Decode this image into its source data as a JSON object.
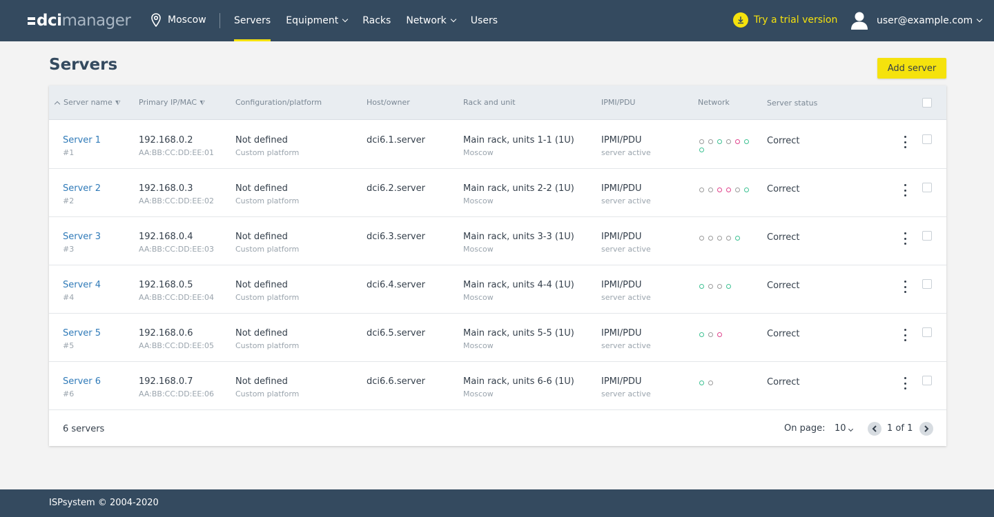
{
  "app": {
    "logo_dci": "dci",
    "logo_manager": "manager"
  },
  "header": {
    "location": "Moscow",
    "nav": [
      {
        "label": "Servers",
        "active": true,
        "dropdown": false
      },
      {
        "label": "Equipment",
        "active": false,
        "dropdown": true
      },
      {
        "label": "Racks",
        "active": false,
        "dropdown": false
      },
      {
        "label": "Network",
        "active": false,
        "dropdown": true
      },
      {
        "label": "Users",
        "active": false,
        "dropdown": false
      }
    ],
    "trial": "Try a trial version",
    "user": "user@example.com"
  },
  "page": {
    "title": "Servers",
    "add_button": "Add server"
  },
  "table": {
    "columns": {
      "name": "Server name",
      "ip": "Primary IP/MAC",
      "config": "Configuration/platform",
      "host": "Host/owner",
      "rack": "Rack and unit",
      "ipmi": "IPMI/PDU",
      "network": "Network",
      "status": "Server status"
    },
    "rows": [
      {
        "name": "Server 1",
        "id": "#1",
        "ip": "192.168.0.2",
        "mac": "AA:BB:CC:DD:EE:01",
        "config": "Not defined",
        "platform": "Custom platform",
        "host": "dci6.1.server",
        "rack": "Main rack, units 1-1 (1U)",
        "rack_loc": "Moscow",
        "ipmi": "IPMI/PDU",
        "ipmi_state": "server active",
        "ports": [
          "x",
          "x",
          "g",
          "x",
          "p",
          "g",
          "g"
        ],
        "status": "Correct"
      },
      {
        "name": "Server 2",
        "id": "#2",
        "ip": "192.168.0.3",
        "mac": "AA:BB:CC:DD:EE:02",
        "config": "Not defined",
        "platform": "Custom platform",
        "host": "dci6.2.server",
        "rack": "Main rack, units 2-2 (1U)",
        "rack_loc": "Moscow",
        "ipmi": "IPMI/PDU",
        "ipmi_state": "server active",
        "ports": [
          "x",
          "x",
          "p",
          "p",
          "x",
          "g"
        ],
        "status": "Correct"
      },
      {
        "name": "Server 3",
        "id": "#3",
        "ip": "192.168.0.4",
        "mac": "AA:BB:CC:DD:EE:03",
        "config": "Not defined",
        "platform": "Custom platform",
        "host": "dci6.3.server",
        "rack": "Main rack, units 3-3 (1U)",
        "rack_loc": "Moscow",
        "ipmi": "IPMI/PDU",
        "ipmi_state": "server active",
        "ports": [
          "x",
          "x",
          "x",
          "x",
          "g"
        ],
        "status": "Correct"
      },
      {
        "name": "Server 4",
        "id": "#4",
        "ip": "192.168.0.5",
        "mac": "AA:BB:CC:DD:EE:04",
        "config": "Not defined",
        "platform": "Custom platform",
        "host": "dci6.4.server",
        "rack": "Main rack, units 4-4 (1U)",
        "rack_loc": "Moscow",
        "ipmi": "IPMI/PDU",
        "ipmi_state": "server active",
        "ports": [
          "g",
          "x",
          "x",
          "g"
        ],
        "status": "Correct"
      },
      {
        "name": "Server 5",
        "id": "#5",
        "ip": "192.168.0.6",
        "mac": "AA:BB:CC:DD:EE:05",
        "config": "Not defined",
        "platform": "Custom platform",
        "host": "dci6.5.server",
        "rack": "Main rack, units 5-5 (1U)",
        "rack_loc": "Moscow",
        "ipmi": "IPMI/PDU",
        "ipmi_state": "server active",
        "ports": [
          "g",
          "x",
          "p"
        ],
        "status": "Correct"
      },
      {
        "name": "Server 6",
        "id": "#6",
        "ip": "192.168.0.7",
        "mac": "AA:BB:CC:DD:EE:06",
        "config": "Not defined",
        "platform": "Custom platform",
        "host": "dci6.6.server",
        "rack": "Main rack, units 6-6 (1U)",
        "rack_loc": "Moscow",
        "ipmi": "IPMI/PDU",
        "ipmi_state": "server active",
        "ports": [
          "g",
          "x"
        ],
        "status": "Correct"
      }
    ],
    "footer": {
      "count": "6 servers",
      "on_page_label": "On page:",
      "per_page": "10",
      "pages": "1 of 1"
    }
  },
  "footer": {
    "copyright": "ISPsystem © 2004-2020"
  },
  "colors": {
    "header": "#344a5f",
    "accent": "#f5e20d",
    "link": "#2f7ab8",
    "port_up": "#3cc192",
    "port_warn": "#e0428c",
    "port_down": "#9a9a9a"
  }
}
